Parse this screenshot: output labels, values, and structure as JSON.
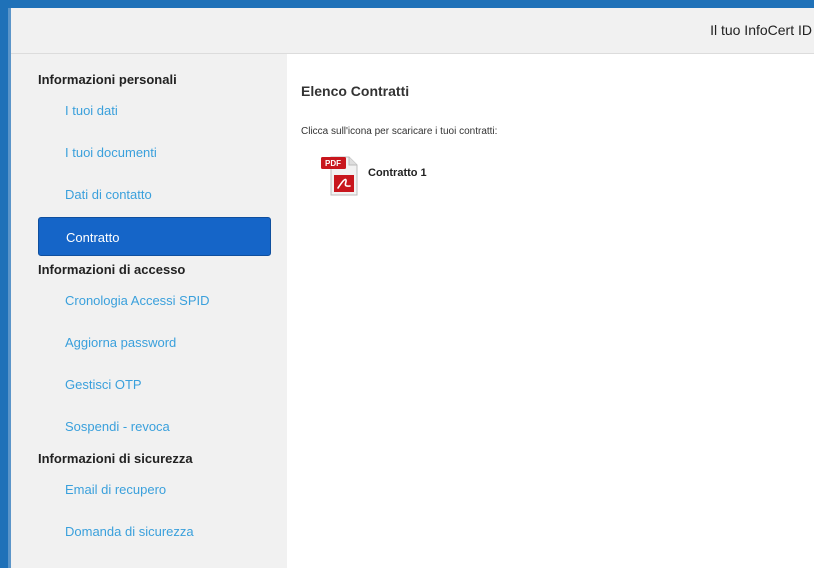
{
  "header": {
    "title": "Il tuo InfoCert ID"
  },
  "sidebar": {
    "sections": [
      {
        "title": "Informazioni personali",
        "items": [
          {
            "label": "I tuoi dati"
          },
          {
            "label": "I tuoi documenti"
          },
          {
            "label": "Dati di contatto"
          },
          {
            "label": "Contratto",
            "active": true
          }
        ]
      },
      {
        "title": "Informazioni di accesso",
        "items": [
          {
            "label": "Cronologia Accessi SPID"
          },
          {
            "label": "Aggiorna password"
          },
          {
            "label": "Gestisci OTP"
          },
          {
            "label": "Sospendi - revoca"
          }
        ]
      },
      {
        "title": "Informazioni di sicurezza",
        "items": [
          {
            "label": "Email di recupero"
          },
          {
            "label": "Domanda di sicurezza"
          }
        ]
      }
    ]
  },
  "main": {
    "title": "Elenco Contratti",
    "instruction": "Clicca sull'icona per scaricare i tuoi contratti:",
    "contracts": [
      {
        "label": "Contratto 1",
        "icon": "pdf-file-icon",
        "badge": "PDF"
      }
    ]
  },
  "colors": {
    "page_border": "#1f71b8",
    "sidebar_bg": "#f1f1f1",
    "link": "#3aa0dc",
    "active_bg": "#1565c8",
    "pdf_red": "#c8161d"
  }
}
